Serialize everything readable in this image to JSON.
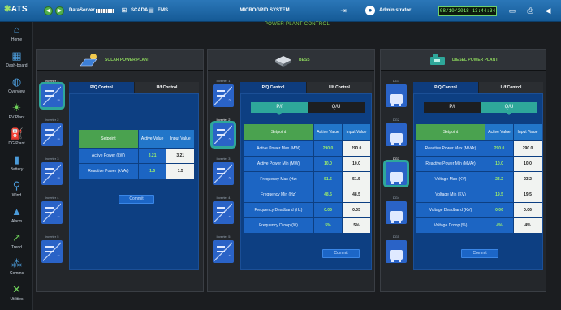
{
  "app": {
    "logo": "ATS",
    "nav_back": "◀",
    "nav_forward": "▶",
    "server_label": "DataServer",
    "scada_label": "SCADA",
    "ems_label": "EMS",
    "system_title": "MICROGRID SYSTEM",
    "user": "Administrator",
    "datetime": "08/10/2018 13:44:34",
    "accent": "#155a96"
  },
  "sidebar": {
    "items": [
      {
        "label": "Home",
        "icon": "home-icon"
      },
      {
        "label": "Dash-board",
        "icon": "dashboard-icon"
      },
      {
        "label": "Overview",
        "icon": "globe-icon"
      },
      {
        "label": "PV Plant",
        "icon": "solar-icon"
      },
      {
        "label": "DG Plant",
        "icon": "generator-icon"
      },
      {
        "label": "Battery",
        "icon": "battery-icon"
      },
      {
        "label": "Wind",
        "icon": "wind-icon"
      },
      {
        "label": "Alarm",
        "icon": "alarm-icon"
      },
      {
        "label": "Trend",
        "icon": "trend-icon"
      },
      {
        "label": "Comms",
        "icon": "comms-icon"
      },
      {
        "label": "Utilities",
        "icon": "tools-icon"
      }
    ]
  },
  "page_title": "POWER PLANT CONTROL",
  "panels": {
    "solar": {
      "title": "SOLAR POWER PLANT",
      "inverters": [
        "Inverter 1",
        "Inverter 2",
        "Inverter 3",
        "Inverter 4",
        "Inverter 5"
      ],
      "tabs": [
        "P/Q Control",
        "U/f Control"
      ],
      "headers": {
        "setpoint": "Setpoint",
        "active": "Active Value",
        "input": "Input Value"
      },
      "rows": [
        {
          "name": "Active Power (kW)",
          "active": "3.21",
          "input": "3.21"
        },
        {
          "name": "Reactive Power (kVAr)",
          "active": "1.5",
          "input": "1.5"
        }
      ],
      "commit": "Commit"
    },
    "bess": {
      "title": "BESS",
      "inverters": [
        "Inverter 1",
        "Inverter 2",
        "Inverter 3",
        "Inverter 4",
        "Inverter 5"
      ],
      "tabs": [
        "P/Q Control",
        "U/f Control"
      ],
      "segments": [
        "P/f",
        "Q/U"
      ],
      "headers": {
        "setpoint": "Setpoint",
        "active": "Active Value",
        "input": "Input Value"
      },
      "rows": [
        {
          "name": "Active Power Max (MW)",
          "active": "290.0",
          "input": "290.0"
        },
        {
          "name": "Active Power Min (MW)",
          "active": "10.0",
          "input": "10.0"
        },
        {
          "name": "Frequency Max (Hz)",
          "active": "51.5",
          "input": "51.5"
        },
        {
          "name": "Frequency Min (Hz)",
          "active": "48.5",
          "input": "48.5"
        },
        {
          "name": "Frequency Deadband (Hz)",
          "active": "0.05",
          "input": "0.05"
        },
        {
          "name": "Frequency Droop (%)",
          "active": "5%",
          "input": "5%"
        }
      ],
      "commit": "Commit"
    },
    "diesel": {
      "title": "DIESEL POWER PLANT",
      "inverters": [
        "DG1",
        "DG2",
        "DG3",
        "DG4",
        "DG5"
      ],
      "tabs": [
        "P/Q Control",
        "U/f Control"
      ],
      "segments": [
        "P/f",
        "Q/U"
      ],
      "headers": {
        "setpoint": "Setpoint",
        "active": "Active Value",
        "input": "Input Value"
      },
      "rows": [
        {
          "name": "Reactive Power Max (MVAr)",
          "active": "290.0",
          "input": "290.0"
        },
        {
          "name": "Reactive Power Min (MVAr)",
          "active": "10.0",
          "input": "10.0"
        },
        {
          "name": "Voltage Max (KV)",
          "active": "23.2",
          "input": "23.2"
        },
        {
          "name": "Voltage Min (KV)",
          "active": "19.5",
          "input": "19.5"
        },
        {
          "name": "Voltage Deadband (KV)",
          "active": "0.06",
          "input": "0.06"
        },
        {
          "name": "Voltage Droop (%)",
          "active": "4%",
          "input": "4%"
        }
      ],
      "commit": "Commit"
    }
  }
}
